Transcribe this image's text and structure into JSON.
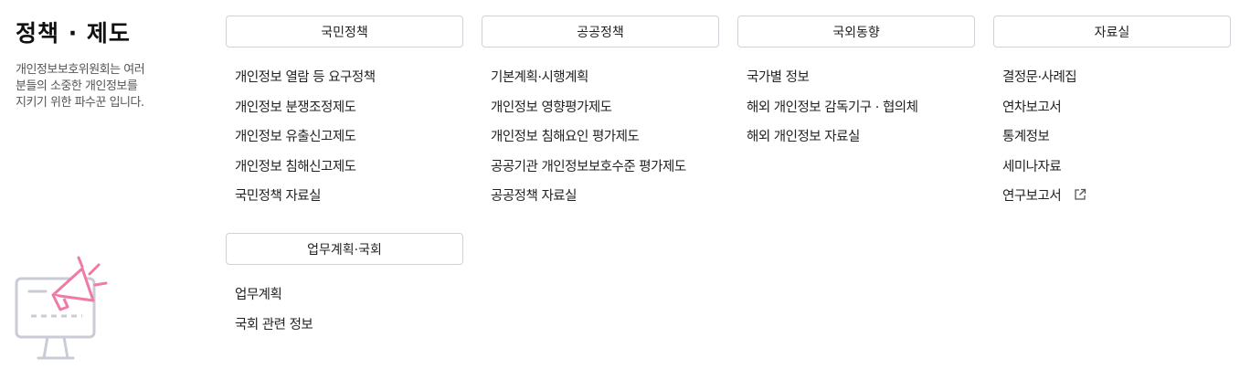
{
  "intro": {
    "title": "정책 · 제도",
    "desc_lines": [
      "개인정보보호위원회는 여러",
      "분들의 소중한 개인정보를",
      "지키기 위한 파수꾼 입니다."
    ]
  },
  "columns": [
    {
      "header": "국민정책",
      "items": [
        "개인정보 열람 등 요구정책",
        "개인정보 분쟁조정제도",
        "개인정보 유출신고제도",
        "개인정보 침해신고제도",
        "국민정책 자료실"
      ]
    },
    {
      "header": "공공정책",
      "items": [
        "기본계획·시행계획",
        "개인정보 영향평가제도",
        "개인정보 침해요인 평가제도",
        "공공기관 개인정보보호수준 평가제도",
        "공공정책 자료실"
      ]
    },
    {
      "header": "국외동향",
      "items": [
        "국가별 정보",
        "해외 개인정보 감독기구 · 협의체",
        "해외 개인정보 자료실"
      ]
    },
    {
      "header": "자료실",
      "items": [
        "결정문·사례집",
        "연차보고서",
        "통계정보",
        "세미나자료",
        "연구보고서"
      ]
    },
    {
      "header": "업무계획·국회",
      "items": [
        "업무계획",
        "국회 관련 정보"
      ]
    }
  ],
  "icons": {
    "illustration": "monitor-megaphone-icon",
    "external_link": "external-link-icon"
  },
  "colors": {
    "accent_pink": "#f07aa6",
    "illustration_gray": "#c9ccd6",
    "border": "#cfd3d9"
  }
}
